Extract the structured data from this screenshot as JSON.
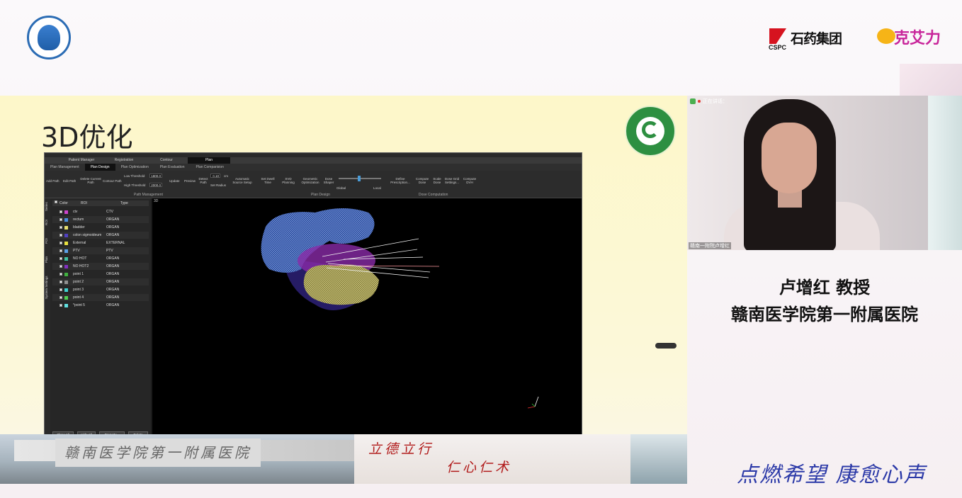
{
  "banner": {
    "assoc_logo": "china-anticancer-association-logo",
    "sponsor1_name": "石药集团",
    "sponsor1_abbr": "CSPC",
    "sponsor2_name": "克艾力"
  },
  "slide": {
    "title": "3D优化",
    "app": {
      "main_tabs": [
        "Patient Manager",
        "Registration",
        "Contour",
        "Plan"
      ],
      "main_tab_active": "Plan",
      "sub_tabs": [
        "Plan Management",
        "Plan Design",
        "Plan Optimization",
        "Plan Evaluation",
        "Plan Comparision"
      ],
      "sub_tab_active": "Plan Design",
      "ribbon": {
        "add_path": "Add Path",
        "edit_path": "Edit Path",
        "delete_current_path": "Delete Current Path",
        "contour_path": "Contour Path",
        "low_threshold_label": "Low Threshold",
        "low_threshold_value": "1800.0",
        "high_threshold_label": "High Threshold",
        "high_threshold_value": "2000.0",
        "update": "Update",
        "preview": "Preview",
        "detect_path": "Detect Path",
        "step_value": "0.10",
        "step_unit": "cm",
        "set_radius": "Set Radius",
        "automatic_source_setup": "Automatic Source Setup",
        "set_dwell_time": "Set Dwell Time",
        "svd_planning": "SVD Planning",
        "geometric_optimization": "Geometric Optimization",
        "dose_shaper": "Dose Shaper",
        "global": "Global",
        "local": "Local",
        "define_prescription": "Define Prescription...",
        "compute_dose": "Compute Dose",
        "scale_dose": "Scale Dose",
        "dose_grid_settings": "Dose Grid Settings...",
        "compute_dvh": "Compute DVH",
        "group_path_management": "Path Management",
        "group_plan_design": "Plan Design",
        "group_dose_computation": "Dose Computation"
      },
      "side_tabs": [
        "Series",
        "ROI",
        "POI",
        "Plan",
        "System Settings"
      ],
      "roi_table": {
        "columns": [
          "Color",
          "ROI",
          "Type"
        ],
        "rows": [
          {
            "name": "ctv",
            "type": "CTV",
            "color": "#cc44cc"
          },
          {
            "name": "rectum",
            "type": "ORGAN",
            "color": "#4a8fe0"
          },
          {
            "name": "bladder",
            "type": "ORGAN",
            "color": "#e8e070"
          },
          {
            "name": "colon sigmoideum",
            "type": "ORGAN",
            "color": "#5040c0"
          },
          {
            "name": "External",
            "type": "EXTERNAL",
            "color": "#e8e040"
          },
          {
            "name": "PTV",
            "type": "PTV",
            "color": "#5aa0e8"
          },
          {
            "name": "NO HOT",
            "type": "ORGAN",
            "color": "#40c0a0"
          },
          {
            "name": "NO HOT2",
            "type": "ORGAN",
            "color": "#8030c0"
          },
          {
            "name": "point 1",
            "type": "ORGAN",
            "color": "#40b040"
          },
          {
            "name": "point 2",
            "type": "ORGAN",
            "color": "#909090"
          },
          {
            "name": "point 3",
            "type": "ORGAN",
            "color": "#40d0d0"
          },
          {
            "name": "point 4",
            "type": "ORGAN",
            "color": "#50d050"
          },
          {
            "name": "*point 5",
            "type": "ORGAN",
            "color": "#60e0e0"
          }
        ]
      },
      "buttons": {
        "show_all": "Show All",
        "hide_all": "Hide All",
        "property": "Property...",
        "delete": "Delete"
      },
      "view_label": "3D"
    },
    "strip": {
      "sign": "赣南医学院第一附属医院",
      "motto1": "立德立行",
      "motto2": "仁心仁术"
    }
  },
  "video": {
    "top_text": "正在讲话：",
    "bottom_text": "赣南一附院卢增红"
  },
  "speaker": {
    "name": "卢增红 教授",
    "institution": "赣南医学院第一附属医院"
  },
  "footer_calligraphy": "点燃希望 康愈心声"
}
